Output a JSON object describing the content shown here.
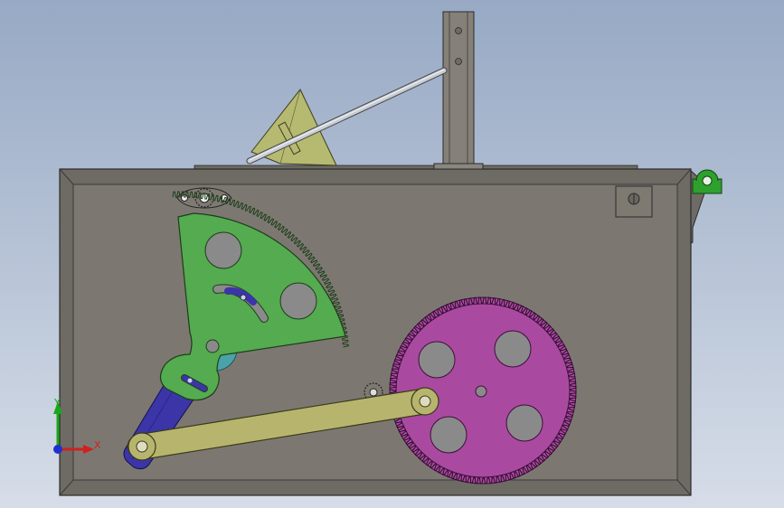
{
  "triad": {
    "x_label": "X",
    "y_label": "Y"
  },
  "colors": {
    "background_top": "#97a9c4",
    "background_bottom": "#d6dde8",
    "housing": "#7e7a72",
    "housing_edge": "#2b2b2b",
    "sector_gear": "#55ab4f",
    "big_gear": "#a94aa0",
    "link_rod": "#b7b56d",
    "crank_arm": "#3b35a8",
    "wedge": "#b6b970",
    "post": "#858078",
    "bracket": "#2ea02e",
    "rod": "#b9bec6",
    "hole": "#8a8a8a"
  }
}
